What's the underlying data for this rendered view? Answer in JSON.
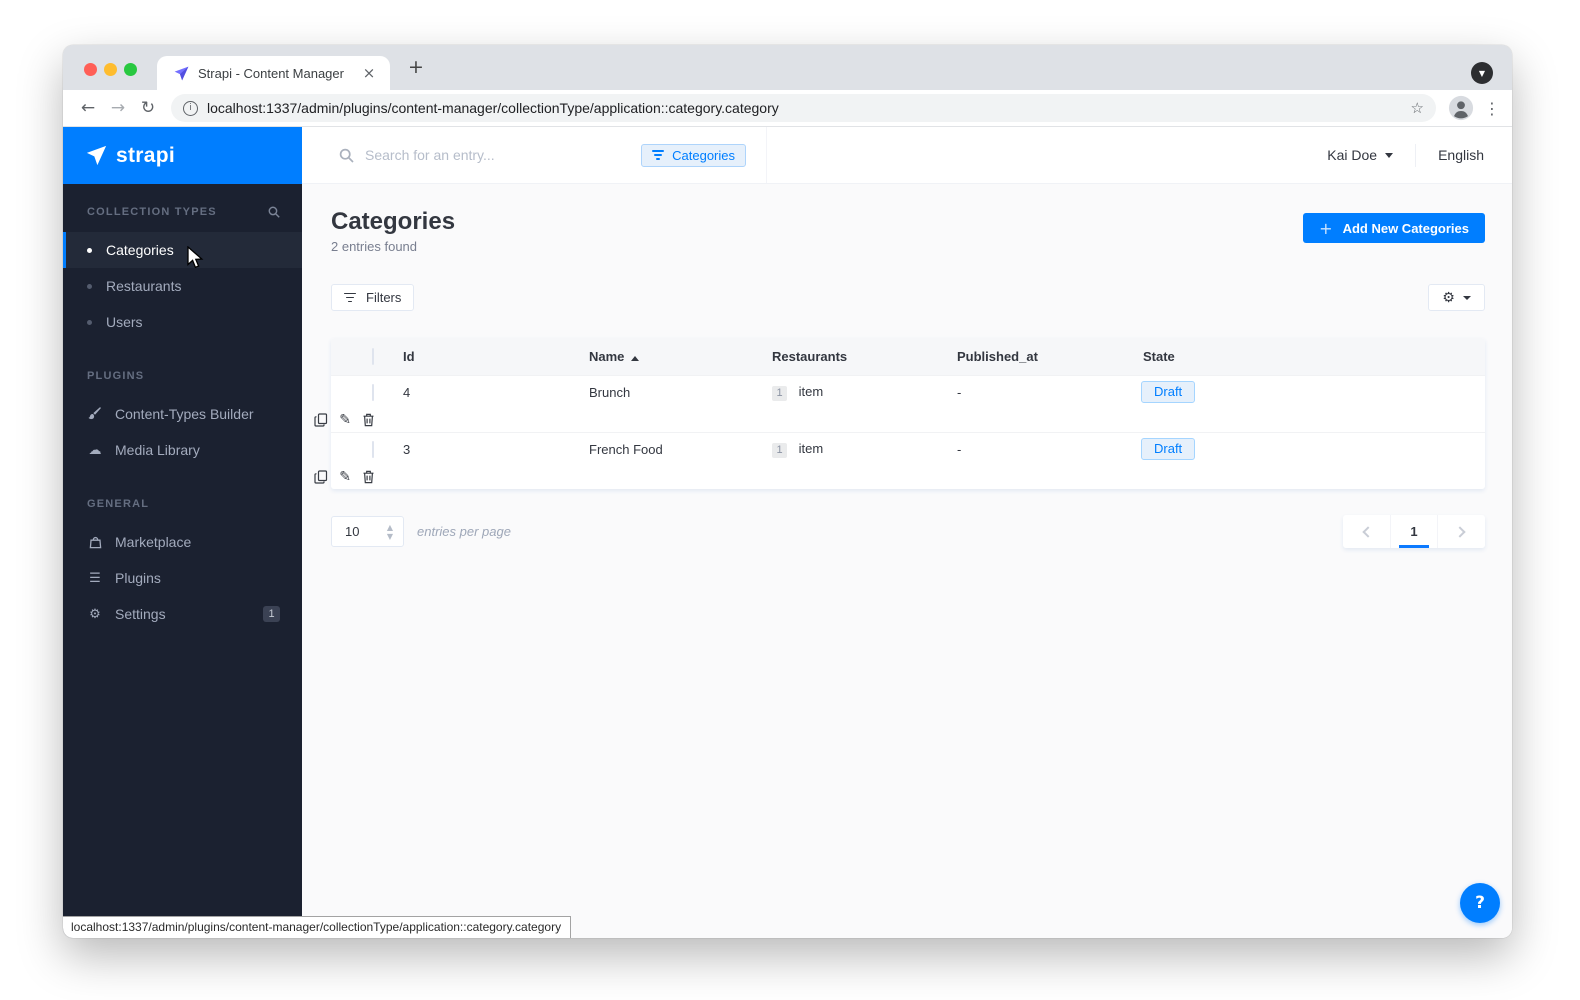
{
  "browser": {
    "tab_title": "Strapi - Content Manager",
    "url": "localhost:1337/admin/plugins/content-manager/collectionType/application::category.category",
    "status_bar_url": "localhost:1337/admin/plugins/content-manager/collectionType/application::category.category"
  },
  "icons": {
    "close": "×",
    "new_tab": "+",
    "back": "←",
    "forward": "→",
    "reload": "↻",
    "info": "i",
    "star": "☆",
    "kebab": "⋮",
    "tab_search_caret": "▼",
    "gear": "⚙",
    "cloud_upload": "☁",
    "list": "☰",
    "pencil": "✎",
    "stepper_up": "▲",
    "stepper_down": "▼",
    "help": "?"
  },
  "sidebar": {
    "logo_text": "strapi",
    "collection_types": {
      "label": "COLLECTION TYPES",
      "items": [
        {
          "label": "Categories",
          "active": true
        },
        {
          "label": "Restaurants",
          "active": false
        },
        {
          "label": "Users",
          "active": false
        }
      ]
    },
    "plugins_section": {
      "label": "PLUGINS",
      "items": [
        {
          "label": "Content-Types Builder",
          "icon": "brush"
        },
        {
          "label": "Media Library",
          "icon": "cloud-upload"
        }
      ]
    },
    "general_section": {
      "label": "GENERAL",
      "items": [
        {
          "label": "Marketplace",
          "icon": "bag"
        },
        {
          "label": "Plugins",
          "icon": "list"
        },
        {
          "label": "Settings",
          "icon": "gear",
          "badge": "1"
        }
      ]
    }
  },
  "header": {
    "search_placeholder": "Search for an entry...",
    "filter_chip_label": "Categories",
    "user_name": "Kai Doe",
    "language": "English"
  },
  "page": {
    "title": "Categories",
    "subtitle": "2 entries found",
    "add_button_label": "Add New Categories",
    "filters_button_label": "Filters"
  },
  "table": {
    "columns": {
      "id": "Id",
      "name": "Name",
      "restaurants": "Restaurants",
      "published_at": "Published_at",
      "state": "State"
    },
    "sort": {
      "column": "Name",
      "direction": "asc"
    },
    "rows": [
      {
        "id": "4",
        "name": "Brunch",
        "restaurants_count": "1",
        "restaurants_unit": "item",
        "published_at": "-",
        "state": "Draft"
      },
      {
        "id": "3",
        "name": "French Food",
        "restaurants_count": "1",
        "restaurants_unit": "item",
        "published_at": "-",
        "state": "Draft"
      }
    ]
  },
  "pagination": {
    "page_size": "10",
    "page_size_label": "entries per page",
    "current_page": "1"
  },
  "colors": {
    "accent": "#007eff",
    "sidebar_bg": "#1b2130",
    "draft_badge_bg": "#e6f0fb",
    "draft_badge_border": "#a5d5ff"
  }
}
